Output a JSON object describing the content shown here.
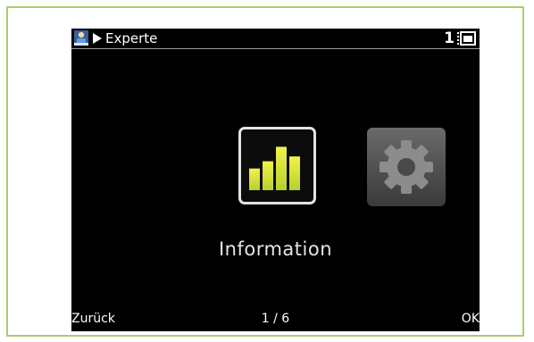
{
  "statusbar": {
    "breadcrumb": "Experte",
    "number": "1",
    "user_icon": "user-icon",
    "play_icon": "play-arrow-icon",
    "card_icon": "memory-card-icon"
  },
  "menu": {
    "items": [
      {
        "icon": "bar-chart-icon",
        "label": "Information",
        "selected": true,
        "bar_levels": [
          0.45,
          0.6,
          0.9,
          0.7
        ]
      },
      {
        "icon": "gear-icon",
        "selected": false
      }
    ],
    "caption": "Information"
  },
  "footer": {
    "back_label": "Zurück",
    "page": "1 / 6",
    "ok_label": "OK"
  },
  "colors": {
    "frame": "#a9cf68",
    "bar_fill_top": "#f0f04a",
    "bar_fill_bottom": "#b8d22a"
  }
}
